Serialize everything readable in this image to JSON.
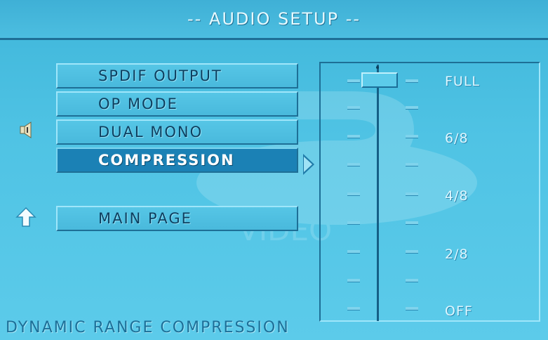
{
  "header": {
    "title": "-- AUDIO SETUP --"
  },
  "menu": {
    "items": [
      {
        "label": "SPDIF OUTPUT"
      },
      {
        "label": "OP MODE"
      },
      {
        "label": "DUAL MONO"
      },
      {
        "label": "COMPRESSION",
        "selected": true
      },
      {
        "label": "MAIN PAGE"
      }
    ]
  },
  "slider": {
    "levels": [
      "FULL",
      "6/8",
      "4/8",
      "2/8",
      "OFF"
    ],
    "current": "FULL",
    "steps": 9,
    "current_step": 0
  },
  "watermark": {
    "text": "VIDEO"
  },
  "status": {
    "text": "DYNAMIC RANGE COMPRESSION"
  },
  "icons": {
    "speaker": "speaker-icon",
    "up": "up-arrow-icon"
  },
  "colors": {
    "background": "#4fc3e4",
    "selected": "#1b81b5",
    "text_dark": "#0e3f5f",
    "text_light": "#dff7ff"
  }
}
